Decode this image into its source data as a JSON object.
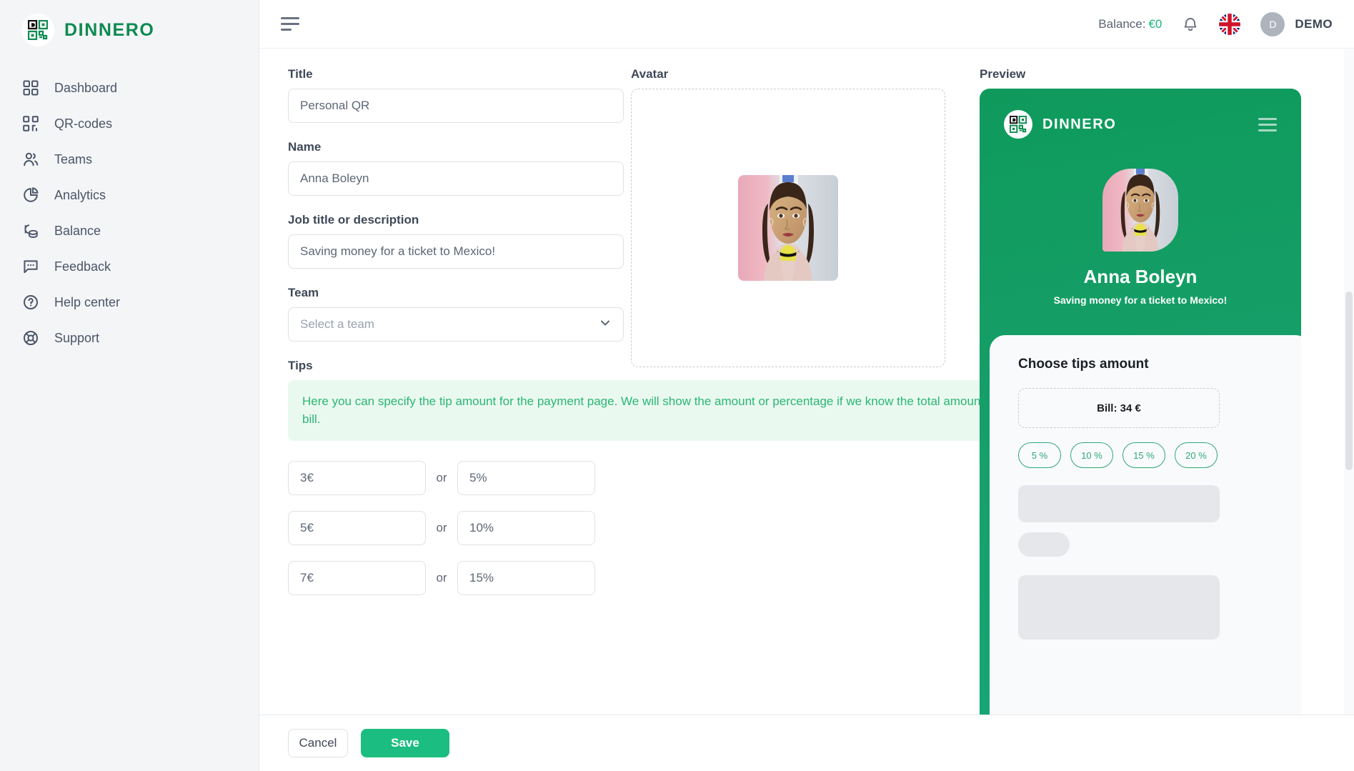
{
  "brand": {
    "name": "DINNERO",
    "logo_icon": "qr-code-logo-icon",
    "accent": "#0e8a51"
  },
  "sidebar": {
    "items": [
      {
        "label": "Dashboard",
        "icon": "grid-icon",
        "name": "dashboard"
      },
      {
        "label": "QR-codes",
        "icon": "qr-code-icon",
        "name": "qr-codes"
      },
      {
        "label": "Teams",
        "icon": "users-icon",
        "name": "teams"
      },
      {
        "label": "Analytics",
        "icon": "pie-chart-icon",
        "name": "analytics"
      },
      {
        "label": "Balance",
        "icon": "coins-icon",
        "name": "balance"
      },
      {
        "label": "Feedback",
        "icon": "chat-icon",
        "name": "feedback"
      },
      {
        "label": "Help center",
        "icon": "question-circle-icon",
        "name": "help-center"
      },
      {
        "label": "Support",
        "icon": "lifebuoy-icon",
        "name": "support"
      }
    ]
  },
  "topbar": {
    "menu_icon": "hamburger-icon",
    "balance_label": "Balance:",
    "balance_value": "€0",
    "balance_color": "#18b87a",
    "bell_icon": "bell-icon",
    "language_flag": "uk-flag-icon",
    "user_initial": "D",
    "user_name": "DEMO"
  },
  "form": {
    "title": {
      "label": "Title",
      "value": "Personal QR"
    },
    "name": {
      "label": "Name",
      "value": "Anna Boleyn"
    },
    "job": {
      "label": "Job title or description",
      "value": "Saving money for a ticket to Mexico!"
    },
    "team": {
      "label": "Team",
      "placeholder": "Select a team",
      "chevron_icon": "chevron-down-icon"
    },
    "tips": {
      "label": "Tips",
      "note": "Here you can specify the tip amount for the payment page. We will show the amount or percentage if we know the total amount of the bill.",
      "or_label": "or",
      "currency_suffix": "€",
      "percent_suffix": "%",
      "rows": [
        {
          "amount": "3",
          "percent": "5"
        },
        {
          "amount": "5",
          "percent": "10"
        },
        {
          "amount": "7",
          "percent": "15"
        }
      ]
    }
  },
  "avatar": {
    "label": "Avatar",
    "dropzone_name": "avatar-dropzone"
  },
  "preview": {
    "label": "Preview",
    "brand": "DINNERO",
    "menu_icon": "hamburger-icon",
    "person_name": "Anna Boleyn",
    "person_desc": "Saving money for a ticket to Mexico!",
    "sheet_title": "Choose tips amount",
    "bill_label": "Bill: 34 €",
    "pills": [
      "5 %",
      "10 %",
      "15 %",
      "20 %"
    ],
    "accent": "#17a06b",
    "pill_color": "#2fa878"
  },
  "footer": {
    "cancel_label": "Cancel",
    "save_label": "Save",
    "save_color": "#1cbd80"
  }
}
